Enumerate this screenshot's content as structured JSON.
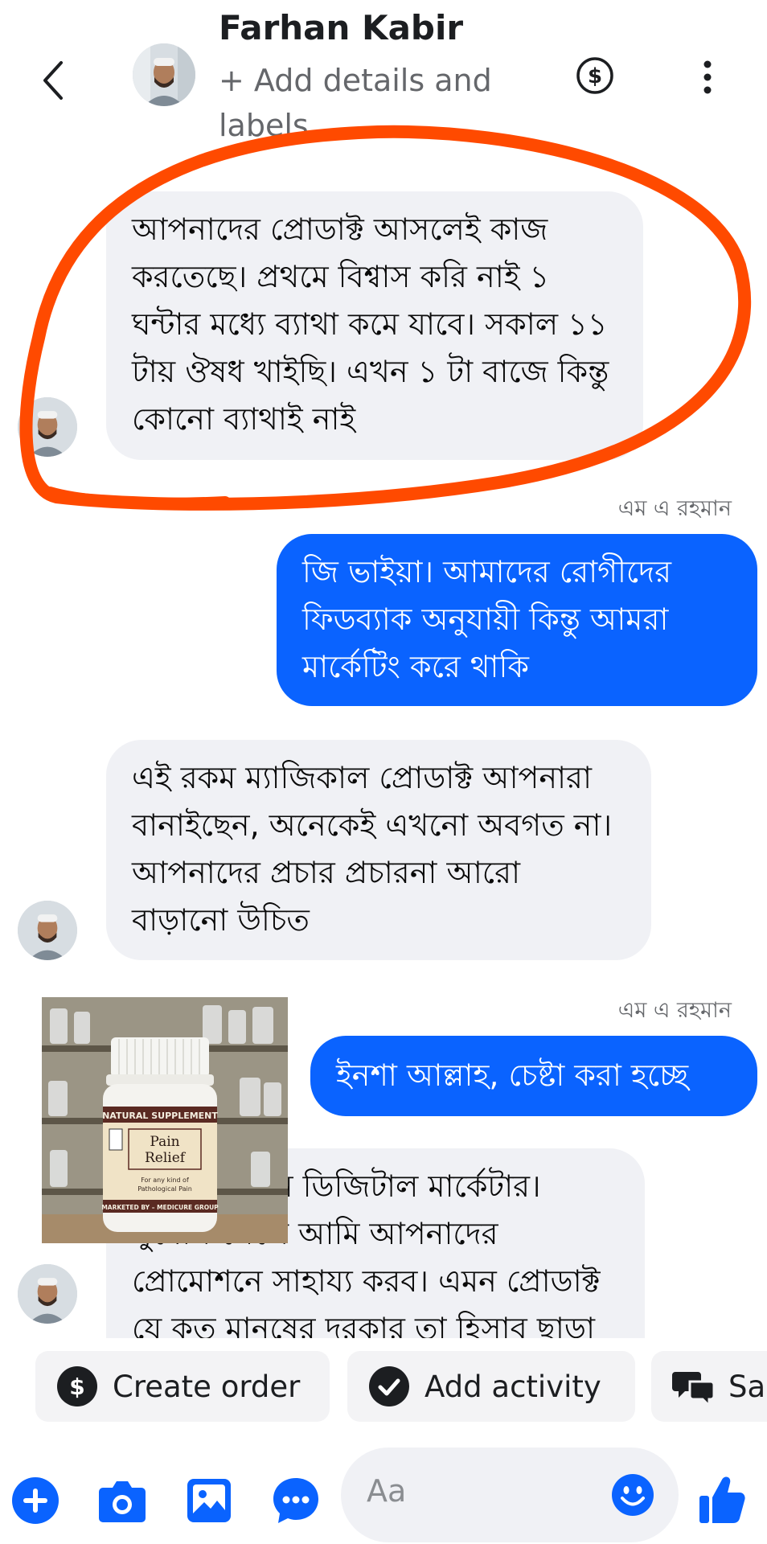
{
  "header": {
    "name": "Farhan Kabir",
    "subtitle": "+ Add details and labels",
    "icons": [
      "back-icon",
      "dollar-icon",
      "more-vertical-icon"
    ]
  },
  "messages": [
    {
      "side": "in",
      "text": "আপনাদের প্রোডাক্ট আসলেই কাজ করতেছে। প্রথমে বিশ্বাস করি নাই ১ ঘন্টার মধ্যে ব্যাথা কমে যাবে। সকাল ১১ টায় ঔষধ খাইছি। এখন ১ টা বাজে কিন্তু কোনো ব্যাথাই নাই"
    },
    {
      "side": "sender",
      "text": "এম এ রহমান"
    },
    {
      "side": "out",
      "text": "জি ভাইয়া। আমাদের রোগীদের ফিডব্যাক অনুযায়ী কিন্তু আমরা মার্কেটিং করে থাকি"
    },
    {
      "side": "in",
      "text": "এই রকম ম্যাজিকাল প্রোডাক্ট আপনারা বানাইছেন, অনেকেই এখনো অবগত না। আপনাদের প্রচার প্রচারনা আরো বাড়ানো উচিত"
    },
    {
      "side": "sender",
      "text": "এম এ রহমান"
    },
    {
      "side": "out",
      "text": "ইনশা আল্লাহ, চেষ্টা করা হচ্ছে"
    },
    {
      "side": "in",
      "text": "আমি একজন ডিজিটাল মার্কেটার। সুযোগ পেলে আমি আপনাদের প্রোমোশনে সাহায্য করব। এমন প্রোডাক্ট যে কত মানুষের দরকার তা হিসাব ছাড়া"
    }
  ],
  "product_image": {
    "cap_label": "NATURAL SUPPLEMENT",
    "title_line1": "Pain",
    "title_line2": "Relief",
    "sub_line1": "For any kind of",
    "sub_line2": "Pathological Pain",
    "bottom_label": "MARKETED BY – MEDICURE GROUP"
  },
  "actions": [
    {
      "label": "Create order",
      "icon": "dollar-circle-icon"
    },
    {
      "label": "Add activity",
      "icon": "check-circle-icon"
    },
    {
      "label": "Sa",
      "icon": "chat-bubbles-icon"
    }
  ],
  "composer": {
    "placeholder": "Aa",
    "icons": [
      "plus-icon",
      "camera-icon",
      "gallery-icon",
      "chat-icon",
      "emoji-icon",
      "thumbs-up-icon"
    ]
  },
  "colors": {
    "accent": "#0a63ff",
    "annotation": "#ff4a00",
    "incoming_bubble": "#f0f1f5"
  }
}
